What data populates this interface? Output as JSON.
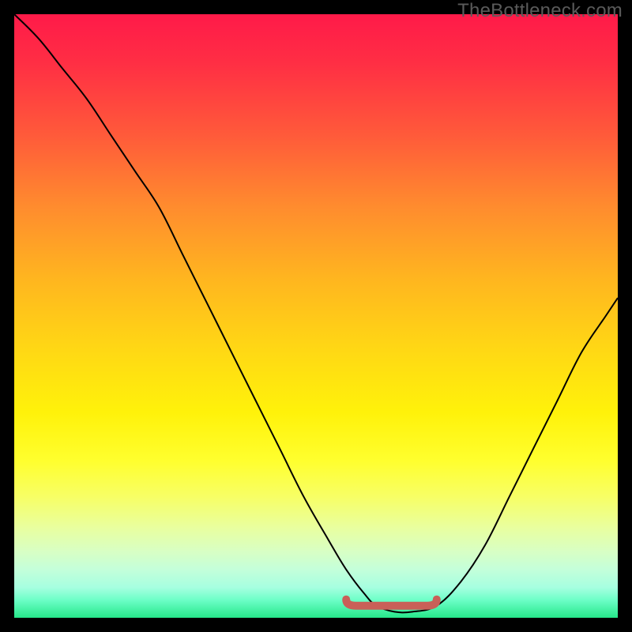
{
  "watermark": "TheBottleneck.com",
  "chart_data": {
    "type": "line",
    "title": "",
    "xlabel": "",
    "ylabel": "",
    "xlim": [
      0,
      100
    ],
    "ylim": [
      0,
      100
    ],
    "series": [
      {
        "name": "bottleneck-curve",
        "x": [
          0,
          4,
          8,
          12,
          16,
          20,
          24,
          28,
          32,
          36,
          40,
          44,
          48,
          52,
          55,
          58,
          60,
          63,
          66,
          70,
          74,
          78,
          82,
          86,
          90,
          94,
          98,
          100
        ],
        "values": [
          100,
          96,
          91,
          86,
          80,
          74,
          68,
          60,
          52,
          44,
          36,
          28,
          20,
          13,
          8,
          4,
          2,
          1,
          1,
          2,
          6,
          12,
          20,
          28,
          36,
          44,
          50,
          53
        ]
      }
    ],
    "annotations": [
      {
        "name": "optimal-flat-region",
        "x_start": 55,
        "x_end": 70,
        "y": 2,
        "color": "#c96058"
      }
    ],
    "gradient_stops": [
      {
        "pos": 0,
        "color": "#ff1a49"
      },
      {
        "pos": 50,
        "color": "#ffd914"
      },
      {
        "pos": 80,
        "color": "#ffff2e"
      },
      {
        "pos": 100,
        "color": "#26e78a"
      }
    ]
  }
}
